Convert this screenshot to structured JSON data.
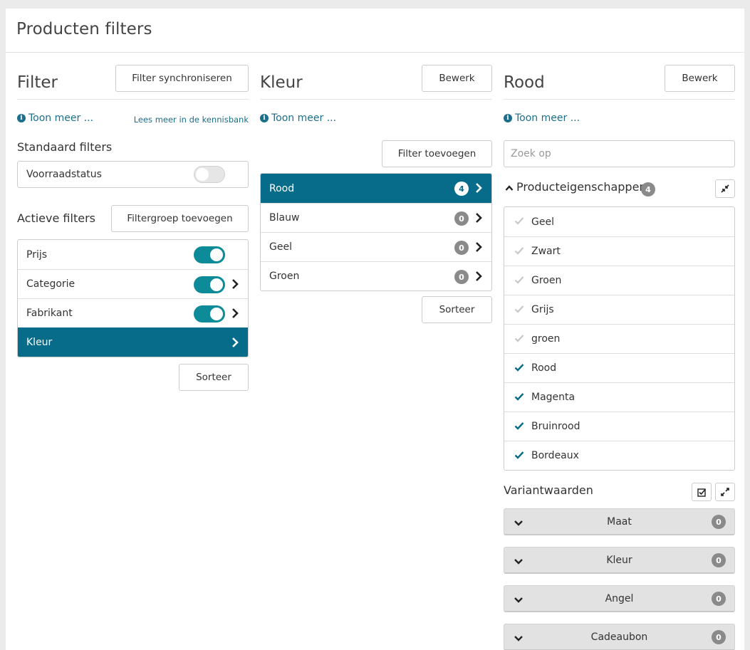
{
  "page": {
    "title": "Producten filters"
  },
  "filter": {
    "title": "Filter",
    "sync_button": "Filter synchroniseren",
    "more_link": "Toon meer ...",
    "kb_link": "Lees meer in de kennisbank",
    "standard_label": "Standaard filters",
    "stock_label": "Voorraadstatus",
    "stock_enabled": false,
    "active_label": "Actieve filters",
    "add_group_button": "Filtergroep toevoegen",
    "active_items": [
      {
        "label": "Prijs",
        "enabled": true,
        "arrow": false
      },
      {
        "label": "Categorie",
        "enabled": true,
        "arrow": true
      },
      {
        "label": "Fabrikant",
        "enabled": true,
        "arrow": true
      },
      {
        "label": "Kleur",
        "selected": true,
        "arrow": true
      }
    ],
    "sort_button": "Sorteer"
  },
  "kleur": {
    "title": "Kleur",
    "edit_button": "Bewerk",
    "more_link": "Toon meer ...",
    "add_filter_button": "Filter toevoegen",
    "items": [
      {
        "label": "Rood",
        "count": "4",
        "selected": true
      },
      {
        "label": "Blauw",
        "count": "0"
      },
      {
        "label": "Geel",
        "count": "0"
      },
      {
        "label": "Groen",
        "count": "0"
      }
    ],
    "sort_button": "Sorteer"
  },
  "rood": {
    "title": "Rood",
    "edit_button": "Bewerk",
    "more_link": "Toon meer ...",
    "search_placeholder": "Zoek op",
    "properties_label": "Producteigenschappen",
    "properties_count": "4",
    "properties": [
      {
        "label": "Geel",
        "checked": false
      },
      {
        "label": "Zwart",
        "checked": false
      },
      {
        "label": "Groen",
        "checked": false
      },
      {
        "label": "Grijs",
        "checked": false
      },
      {
        "label": "groen",
        "checked": false
      },
      {
        "label": "Rood",
        "checked": true
      },
      {
        "label": "Magenta",
        "checked": true
      },
      {
        "label": "Bruinrood",
        "checked": true
      },
      {
        "label": "Bordeaux",
        "checked": true
      }
    ],
    "variants_label": "Variantwaarden",
    "variants": [
      {
        "label": "Maat",
        "count": "0"
      },
      {
        "label": "Kleur",
        "count": "0"
      },
      {
        "label": "Angel",
        "count": "0"
      },
      {
        "label": "Cadeaubon",
        "count": "0"
      }
    ]
  },
  "colors": {
    "accent": "#076c89",
    "toggle_on": "#0e8b98",
    "link": "#1b6f8a",
    "check_on": "#076c89",
    "check_off": "#c8c8c8"
  }
}
